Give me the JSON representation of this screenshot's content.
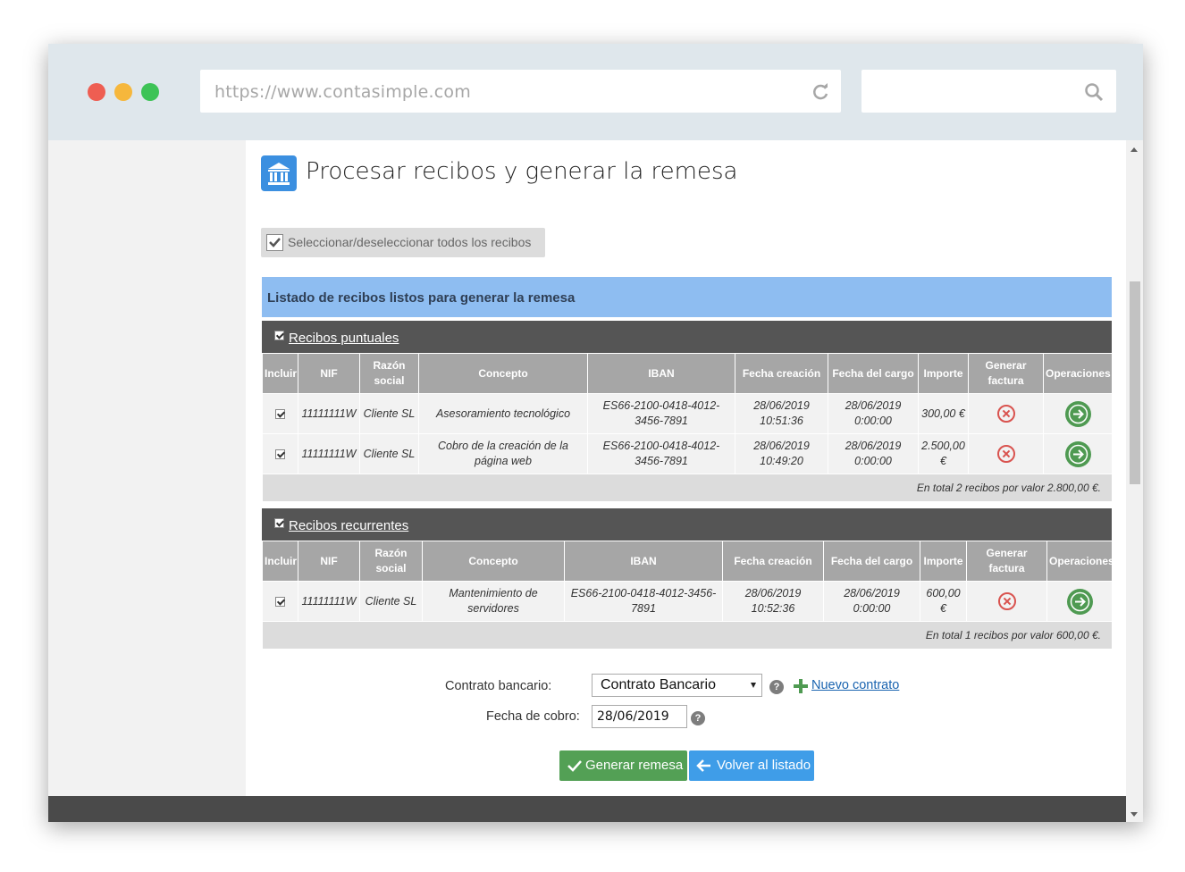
{
  "browser": {
    "url": "https://www.contasimple.com"
  },
  "page": {
    "title": "Procesar recibos y generar la remesa",
    "select_all_label": "Seleccionar/deseleccionar todos los recibos",
    "list_header": "Listado de recibos listos para generar la remesa"
  },
  "columns": [
    "Incluir",
    "NIF",
    "Razón social",
    "Concepto",
    "IBAN",
    "Fecha creación",
    "Fecha del cargo",
    "Importe",
    "Generar factura",
    "Operaciones"
  ],
  "puntuales": {
    "title": "Recibos puntuales",
    "rows": [
      {
        "nif": "11111111W",
        "razon": "Cliente SL",
        "concepto": "Asesoramiento tecnológico",
        "iban": "ES66-2100-0418-4012-3456-7891",
        "fecha_creacion": "28/06/2019 10:51:36",
        "fecha_cargo": "28/06/2019 0:00:00",
        "importe": "300,00 €"
      },
      {
        "nif": "11111111W",
        "razon": "Cliente SL",
        "concepto": "Cobro de la creación de la página web",
        "iban": "ES66-2100-0418-4012-3456-7891",
        "fecha_creacion": "28/06/2019 10:49:20",
        "fecha_cargo": "28/06/2019 0:00:00",
        "importe": "2.500,00 €"
      }
    ],
    "total": "En total 2 recibos por valor 2.800,00 €."
  },
  "recurrentes": {
    "title": "Recibos recurrentes",
    "rows": [
      {
        "nif": "11111111W",
        "razon": "Cliente SL",
        "concepto": "Mantenimiento de servidores",
        "iban": "ES66-2100-0418-4012-3456-7891",
        "fecha_creacion": "28/06/2019 10:52:36",
        "fecha_cargo": "28/06/2019 0:00:00",
        "importe": "600,00 €"
      }
    ],
    "total": "En total 1 recibos por valor 600,00 €."
  },
  "form": {
    "contrato_label": "Contrato bancario:",
    "contrato_value": "Contrato Bancario",
    "nuevo_contrato": "Nuevo contrato",
    "fecha_label": "Fecha de cobro:",
    "fecha_value": "28/06/2019",
    "help_glyph": "?"
  },
  "buttons": {
    "generar": "Generar remesa",
    "volver": "Volver al listado"
  },
  "colors": {
    "accent_blue": "#3f9de8",
    "accent_green": "#53a055",
    "list_header_bg": "#8ebdf1",
    "section_header_bg": "#555555",
    "remove_red": "#d9534f"
  }
}
